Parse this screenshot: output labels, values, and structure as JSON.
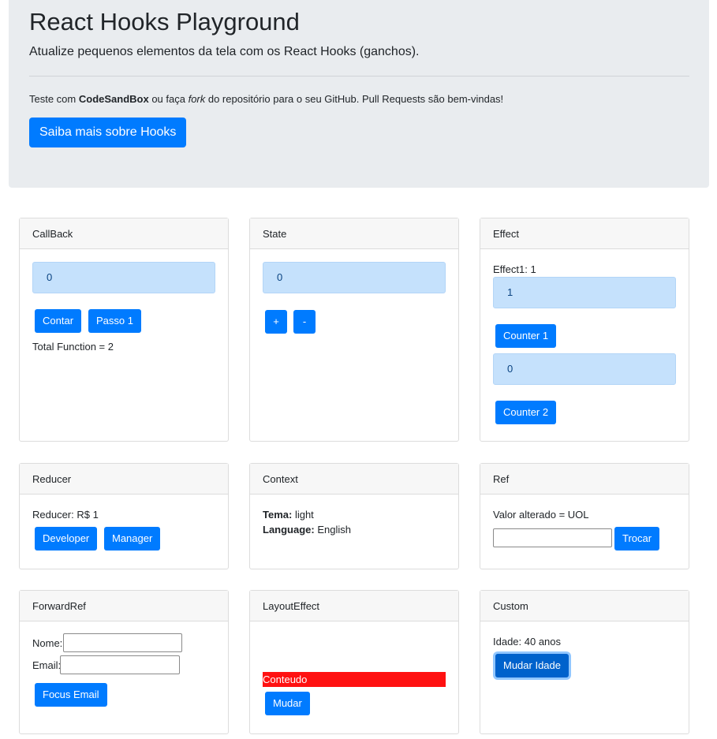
{
  "header": {
    "title": "React Hooks Playground",
    "lead": "Atualize pequenos elementos da tela com os React Hooks (ganchos).",
    "text_prefix": "Teste com ",
    "text_bold": "CodeSandBox",
    "text_mid": " ou faça ",
    "text_italic": "fork",
    "text_suffix": " do repositório para o seu GitHub. Pull Requests são bem-vindas!",
    "button_label": "Saiba mais sobre Hooks"
  },
  "cards": {
    "callback": {
      "title": "CallBack",
      "value": "0",
      "count_button": "Contar",
      "step_button": "Passo 1",
      "total": "Total Function = 2"
    },
    "state": {
      "title": "State",
      "value": "0",
      "plus_button": "+",
      "minus_button": "-"
    },
    "effect": {
      "title": "Effect",
      "effect1_label": "Effect1: 1",
      "value1": "1",
      "counter1_button": "Counter 1",
      "value2": "0",
      "counter2_button": "Counter 2"
    },
    "reducer": {
      "title": "Reducer",
      "text": "Reducer: R$ 1",
      "developer_button": "Developer",
      "manager_button": "Manager"
    },
    "context": {
      "title": "Context",
      "theme_label": "Tema:",
      "theme_value": " light",
      "language_label": "Language:",
      "language_value": " English"
    },
    "ref": {
      "title": "Ref",
      "text": "Valor alterado = UOL",
      "input_value": "",
      "swap_button": "Trocar"
    },
    "forwardref": {
      "title": "ForwardRef",
      "name_label": "Nome:",
      "name_value": "",
      "email_label": "Email:",
      "email_value": "",
      "focus_button": "Focus Email"
    },
    "layouteffect": {
      "title": "LayoutEffect",
      "content": "Conteudo",
      "change_button": "Mudar"
    },
    "custom": {
      "title": "Custom",
      "age_text": "Idade: 40 anos",
      "change_age_button": "Mudar Idade"
    }
  }
}
